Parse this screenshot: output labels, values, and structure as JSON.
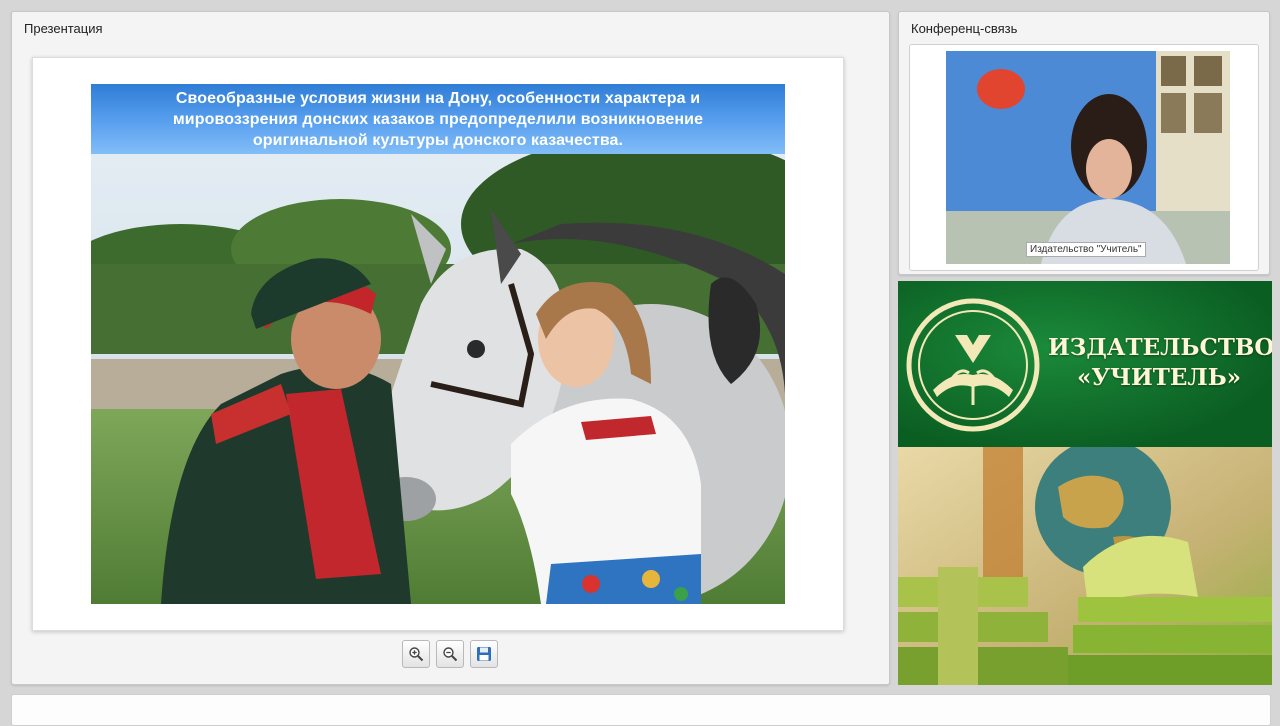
{
  "presentation": {
    "title": "Презентация",
    "slide": {
      "header_text": "Своеобразные условия жизни на Дону, особенности характера и мировоззрения донских казаков предопределили возникновение оригинальной культуры донского казачества."
    },
    "toolbar": {
      "zoom_in": "zoom-in-icon",
      "zoom_out": "zoom-out-icon",
      "save": "save-icon"
    }
  },
  "conference": {
    "title": "Конференц-связь",
    "video_caption": "Издательство \"Учитель\""
  },
  "banner": {
    "name_line1": "ИЗДАТЕЛЬСТВО",
    "name_line2": "«УЧИТЕЛЬ»"
  },
  "colors": {
    "slide_header": "#3a88e0",
    "banner_green": "#0e6b2a",
    "banner_text": "#fff6d8"
  }
}
